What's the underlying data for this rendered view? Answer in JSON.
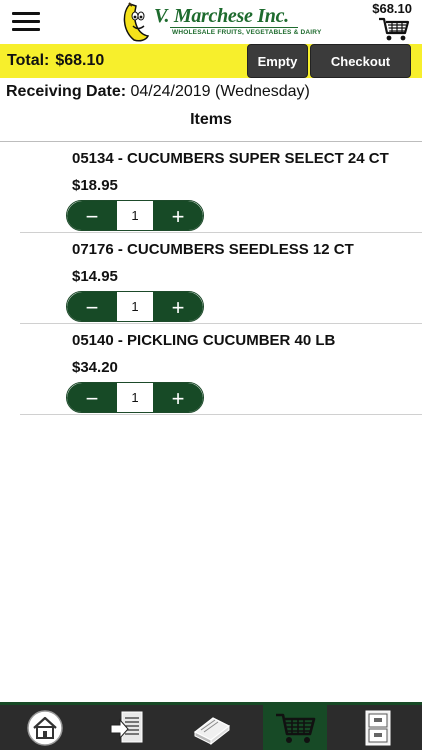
{
  "header": {
    "brand_name": "V. Marchese Inc.",
    "brand_tagline": "WHOLESALE FRUITS, VEGETABLES & DAIRY",
    "cart_total": "$68.10",
    "menu_icon": "hamburger-menu-icon",
    "cart_icon": "shopping-cart-icon"
  },
  "summary": {
    "total_label": "Total:",
    "total_value": "$68.10",
    "empty_label": "Empty",
    "checkout_label": "Checkout"
  },
  "receiving": {
    "label": "Receiving Date:",
    "value": "04/24/2019 (Wednesday)"
  },
  "items_heading": "Items",
  "items": [
    {
      "name": "05134 - CUCUMBERS SUPER SELECT 24 CT",
      "price": "$18.95",
      "quantity": "1",
      "minus": "−",
      "plus": "+"
    },
    {
      "name": "07176 - CUCUMBERS SEEDLESS 12 CT",
      "price": "$14.95",
      "quantity": "1",
      "minus": "−",
      "plus": "+"
    },
    {
      "name": "05140 - PICKLING CUCUMBER 40 LB",
      "price": "$34.20",
      "quantity": "1",
      "minus": "−",
      "plus": "+"
    }
  ],
  "tabs": [
    {
      "icon": "home-icon",
      "active": false
    },
    {
      "icon": "order-list-icon",
      "active": false
    },
    {
      "icon": "catalog-book-icon",
      "active": false
    },
    {
      "icon": "shopping-cart-icon",
      "active": true
    },
    {
      "icon": "filing-cabinet-icon",
      "active": false
    }
  ],
  "colors": {
    "brand_green": "#174a26",
    "total_bar_yellow": "#f7ef2c",
    "dark_button": "#3b3b3b",
    "tabbar_background": "#2c2c2c"
  }
}
